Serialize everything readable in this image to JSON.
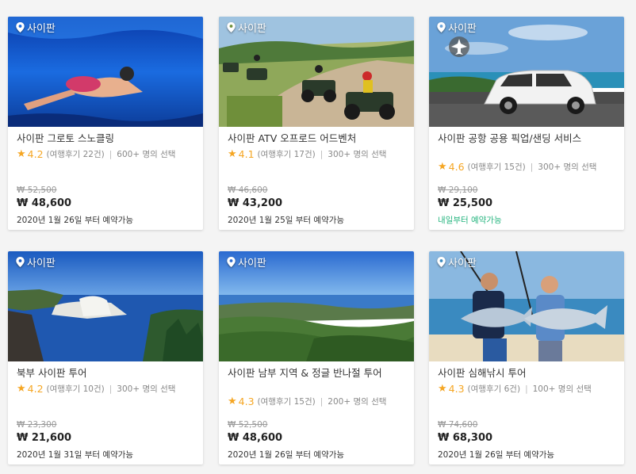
{
  "colors": {
    "star": "#f5a623",
    "green_available": "#24b47e"
  },
  "cards": [
    {
      "location": "사이판",
      "title": "사이판 그로토 스노클링",
      "rating": "4.2",
      "reviews": "(여행후기 22건)",
      "booked": "600+ 명의 선택",
      "original_price": "₩ 52,500",
      "price": "₩ 48,600",
      "availability": "2020년 1월 26일 부터 예약가능"
    },
    {
      "location": "사이판",
      "title": "사이판 ATV 오프로드 어드벤처",
      "rating": "4.1",
      "reviews": "(여행후기 17건)",
      "booked": "300+ 명의 선택",
      "original_price": "₩ 46,600",
      "price": "₩ 43,200",
      "availability": "2020년 1월 25일 부터 예약가능"
    },
    {
      "location": "사이판",
      "title": "사이판 공항 공용 픽업/샌딩 서비스",
      "rating": "4.6",
      "reviews": "(여행후기 15건)",
      "booked": "300+ 명의 선택",
      "original_price": "₩ 29,100",
      "price": "₩ 25,500",
      "availability": "내일부터 예약가능"
    },
    {
      "location": "사이판",
      "title": "북부 사이판 투어",
      "rating": "4.2",
      "reviews": "(여행후기 10건)",
      "booked": "300+ 명의 선택",
      "original_price": "₩ 23,300",
      "price": "₩ 21,600",
      "availability": "2020년 1월 31일 부터 예약가능"
    },
    {
      "location": "사이판",
      "title": "사이판 남부 지역 & 정글 반나절 투어",
      "rating": "4.3",
      "reviews": "(여행후기 15건)",
      "booked": "200+ 명의 선택",
      "original_price": "₩ 52,500",
      "price": "₩ 48,600",
      "availability": "2020년 1월 26일 부터 예약가능"
    },
    {
      "location": "사이판",
      "title": "사이판 심해낚시 투어",
      "rating": "4.3",
      "reviews": "(여행후기 6건)",
      "booked": "100+ 명의 선택",
      "original_price": "₩ 74,600",
      "price": "₩ 68,300",
      "availability": "2020년 1월 26일 부터 예약가능"
    }
  ]
}
